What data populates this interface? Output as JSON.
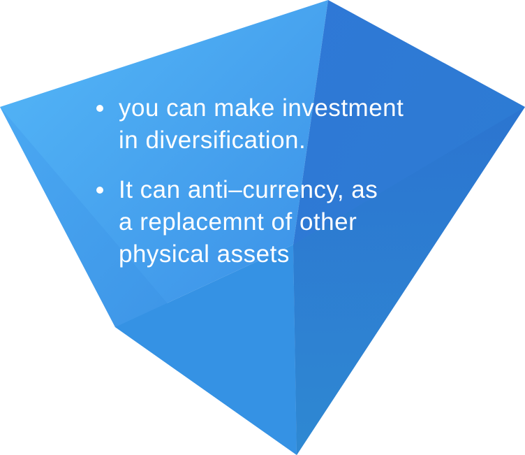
{
  "colors": {
    "left_face_light": "#52b4f7",
    "left_face_dark": "#3796ea",
    "right_face_light": "#2e7fd8",
    "right_face_dark": "#2a6fcf",
    "bottom_tip": "#2f86d4"
  },
  "bullets": [
    {
      "text": "you can make investment\nin diversification."
    },
    {
      "text": "It can anti–currency,  as\na replacemnt of other\nphysical assets"
    }
  ]
}
